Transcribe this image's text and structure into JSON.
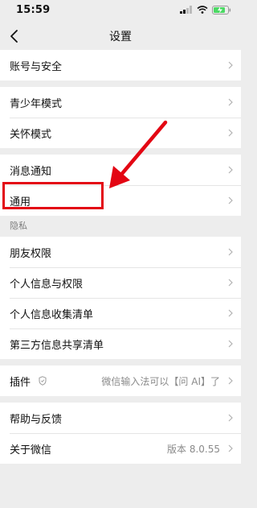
{
  "status_bar": {
    "time": "15:59"
  },
  "nav": {
    "title": "设置"
  },
  "groups": [
    {
      "rows": [
        {
          "label": "账号与安全"
        }
      ]
    },
    {
      "rows": [
        {
          "label": "青少年模式"
        },
        {
          "label": "关怀模式"
        }
      ]
    },
    {
      "rows": [
        {
          "label": "消息通知"
        },
        {
          "label": "通用"
        }
      ]
    },
    {
      "section_label": "隐私",
      "rows": [
        {
          "label": "朋友权限"
        },
        {
          "label": "个人信息与权限"
        },
        {
          "label": "个人信息收集清单"
        },
        {
          "label": "第三方信息共享清单"
        }
      ]
    },
    {
      "rows": [
        {
          "label": "插件",
          "value": "微信输入法可以【问 AI】了"
        }
      ]
    },
    {
      "rows": [
        {
          "label": "帮助与反馈"
        },
        {
          "label": "关于微信",
          "value": "版本 8.0.55"
        }
      ]
    }
  ],
  "colors": {
    "highlight": "#e30613",
    "background": "#ededed",
    "battery": "#4cd964"
  }
}
